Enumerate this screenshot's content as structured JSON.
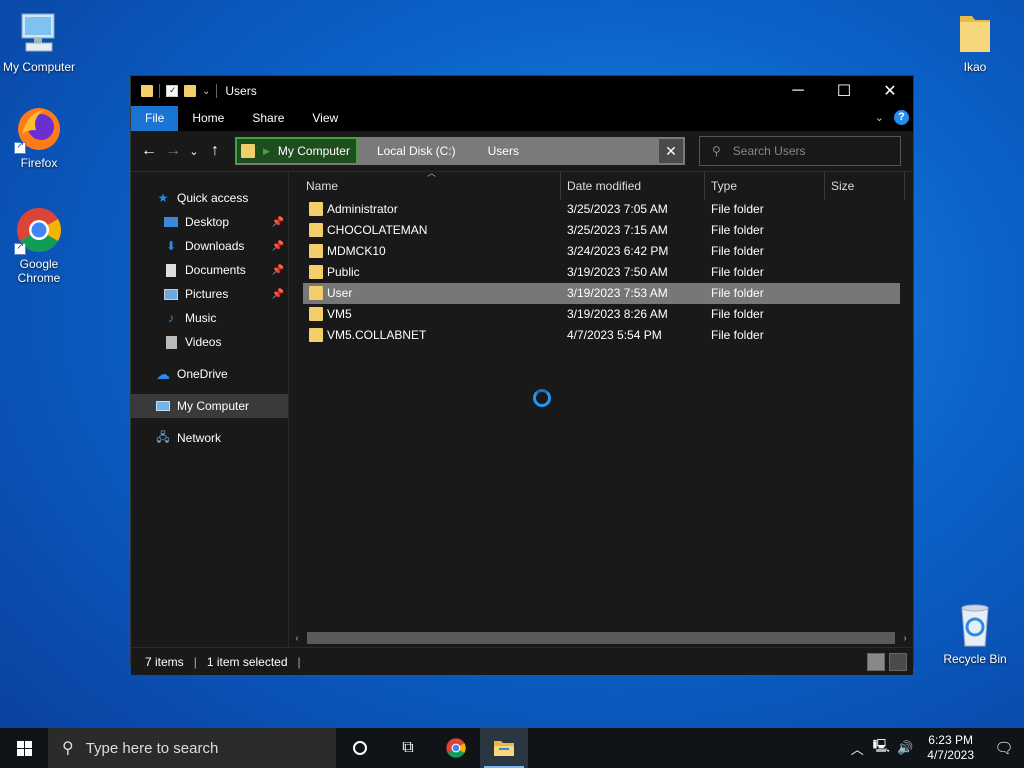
{
  "desktop": {
    "icons": [
      {
        "label": "My Computer"
      },
      {
        "label": "Firefox"
      },
      {
        "label": "Google Chrome"
      },
      {
        "label": "Ikao"
      },
      {
        "label": "Recycle Bin"
      }
    ]
  },
  "window": {
    "title": "Users",
    "controls": {
      "minimize": "─",
      "maximize": "☐",
      "close": "✕"
    },
    "ribbon": {
      "tabs": [
        "File",
        "Home",
        "Share",
        "View"
      ],
      "help": "?"
    },
    "nav": {
      "back": "←",
      "forward": "→",
      "recent": "⌄",
      "up": "↑"
    },
    "address": {
      "crumbs": [
        "My Computer",
        "Local Disk (C:)",
        "Users"
      ],
      "clear": "✕"
    },
    "search": {
      "placeholder": "Search Users"
    },
    "sidebar": {
      "quick_access": "Quick access",
      "quick_items": [
        "Desktop",
        "Downloads",
        "Documents",
        "Pictures",
        "Music",
        "Videos"
      ],
      "onedrive": "OneDrive",
      "my_computer": "My Computer",
      "network": "Network"
    },
    "columns": [
      "Name",
      "Date modified",
      "Type",
      "Size"
    ],
    "files": [
      {
        "name": "Administrator",
        "date": "3/25/2023 7:05 AM",
        "type": "File folder",
        "size": ""
      },
      {
        "name": "CHOCOLATEMAN",
        "date": "3/25/2023 7:15 AM",
        "type": "File folder",
        "size": ""
      },
      {
        "name": "MDMCK10",
        "date": "3/24/2023 6:42 PM",
        "type": "File folder",
        "size": ""
      },
      {
        "name": "Public",
        "date": "3/19/2023 7:50 AM",
        "type": "File folder",
        "size": ""
      },
      {
        "name": "User",
        "date": "3/19/2023 7:53 AM",
        "type": "File folder",
        "size": ""
      },
      {
        "name": "VM5",
        "date": "3/19/2023 8:26 AM",
        "type": "File folder",
        "size": ""
      },
      {
        "name": "VM5.COLLABNET",
        "date": "4/7/2023 5:54 PM",
        "type": "File folder",
        "size": ""
      }
    ],
    "selected_file": "User",
    "status": {
      "items": "7 items",
      "selected": "1 item selected"
    }
  },
  "taskbar": {
    "search_placeholder": "Type here to search",
    "clock_time": "6:23 PM",
    "clock_date": "4/7/2023"
  },
  "colors": {
    "accent": "#1a75d2",
    "folder": "#f4ce6b",
    "selection": "#777777",
    "window_bg": "#191919"
  }
}
